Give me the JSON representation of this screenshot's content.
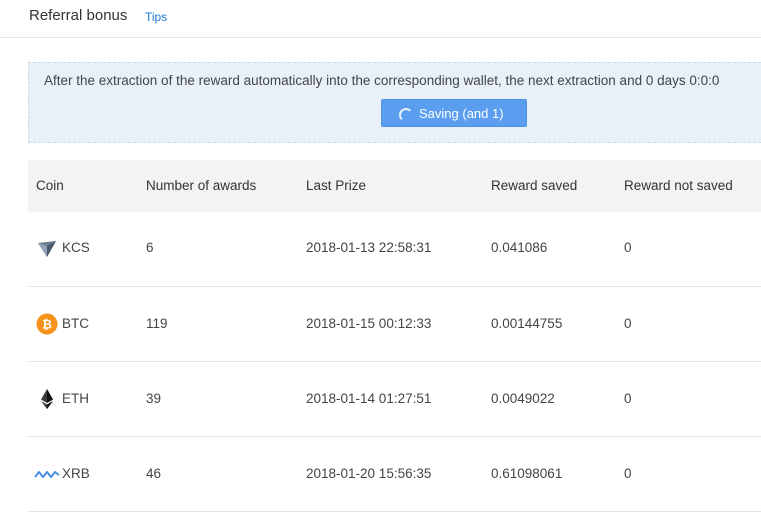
{
  "header": {
    "title": "Referral bonus",
    "tips_label": "Tips"
  },
  "notice": {
    "text": "After the extraction of the reward automatically into the corresponding wallet, the next extraction and 0 days 0:0:0",
    "button_label": "Saving (and 1)"
  },
  "table": {
    "columns": [
      "Coin",
      "Number of awards",
      "Last Prize",
      "Reward saved",
      "Reward not saved"
    ],
    "rows": [
      {
        "icon": "kcs-coin-icon",
        "coin": "KCS",
        "awards": "6",
        "last_prize": "2018-01-13 22:58:31",
        "saved": "0.041086",
        "not_saved": "0"
      },
      {
        "icon": "btc-coin-icon",
        "coin": "BTC",
        "awards": "119",
        "last_prize": "2018-01-15 00:12:33",
        "saved": "0.00144755",
        "not_saved": "0"
      },
      {
        "icon": "eth-coin-icon",
        "coin": "ETH",
        "awards": "39",
        "last_prize": "2018-01-14 01:27:51",
        "saved": "0.0049022",
        "not_saved": "0"
      },
      {
        "icon": "xrb-coin-icon",
        "coin": "XRB",
        "awards": "46",
        "last_prize": "2018-01-20 15:56:35",
        "saved": "0.61098061",
        "not_saved": "0"
      }
    ]
  },
  "colors": {
    "accent": "#5b9ef0",
    "link": "#1a7ad9",
    "notice_bg": "#e8f1fa",
    "btc": "#f7931a"
  }
}
